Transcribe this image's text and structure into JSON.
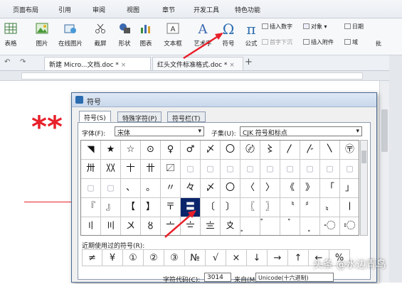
{
  "menubar": {
    "tabs": [
      "页面布局",
      "引用",
      "审阅",
      "视图",
      "章节",
      "开发工具",
      "特色功能"
    ]
  },
  "ribbon": {
    "big_buttons": [
      "表格",
      "图片",
      "在线图片",
      "截屏",
      "形状",
      "图表",
      "文本框",
      "艺术字",
      "符号",
      "公式"
    ],
    "small_buttons": [
      "插入数字",
      "对象",
      "日期",
      "首字下沉",
      "插入附件",
      "域"
    ],
    "right_partial": "批"
  },
  "doc_tabs": {
    "tab1": "新建 Micro...文档.doc *",
    "tab2": "红头文件标准格式.doc *",
    "add": "+"
  },
  "document": {
    "text": "**"
  },
  "dialog": {
    "title": "符号",
    "tabs": [
      "符号(S)",
      "特殊字符(P)",
      "符号栏(T)"
    ],
    "font_label": "字体(F):",
    "font_value": "宋体",
    "subset_label": "子集(U):",
    "subset_value": "CJK 符号和标点",
    "grid_rows": [
      [
        "◥",
        "★",
        "☆",
        "⊙",
        "♀",
        "♂",
        "〆",
        "〇",
        "〄",
        "〻",
        "〳",
        "〴",
        "〵",
        "〶"
      ],
      [
        "〺",
        "〷",
        "〸",
        "〹",
        "〼",
        "",
        "",
        "",
        "",
        "",
        "",
        "",
        "",
        ""
      ],
      [
        "",
        "",
        "、",
        "。",
        "〃",
        "々",
        "〆",
        "〇",
        "〈",
        "〉",
        "《",
        "》",
        "「",
        "」"
      ],
      [
        "『",
        "』",
        "【",
        "】",
        "〒",
        "〓",
        "〔",
        "〕",
        "〖",
        "〗",
        "〝",
        "〞",
        "〟",
        "〡"
      ],
      [
        "〢",
        "〣",
        "〤",
        "〥",
        "〦",
        "〧",
        "〨",
        "〩",
        "〪",
        "〫",
        "〬",
        "〭",
        "〮",
        "〯"
      ]
    ],
    "selected_cell": "〓",
    "recent_label": "近期使用过的符号(R):",
    "recent": [
      "≠",
      "¥",
      "①",
      "②",
      "③",
      "№",
      "√",
      "×",
      "↓",
      "→",
      "↑",
      "←",
      "%"
    ],
    "charcode_label": "字符代码(C):",
    "charcode_value": "3014",
    "from_label": "来自(M)",
    "from_value": "Unicode(十六进制)"
  },
  "watermark": "头条 @水边青鸟",
  "colors": {
    "arrow": "#e8202a",
    "selection": "#0a246a",
    "title_bg": "#c9d8ec",
    "accent_blue": "#2b6cb0"
  }
}
